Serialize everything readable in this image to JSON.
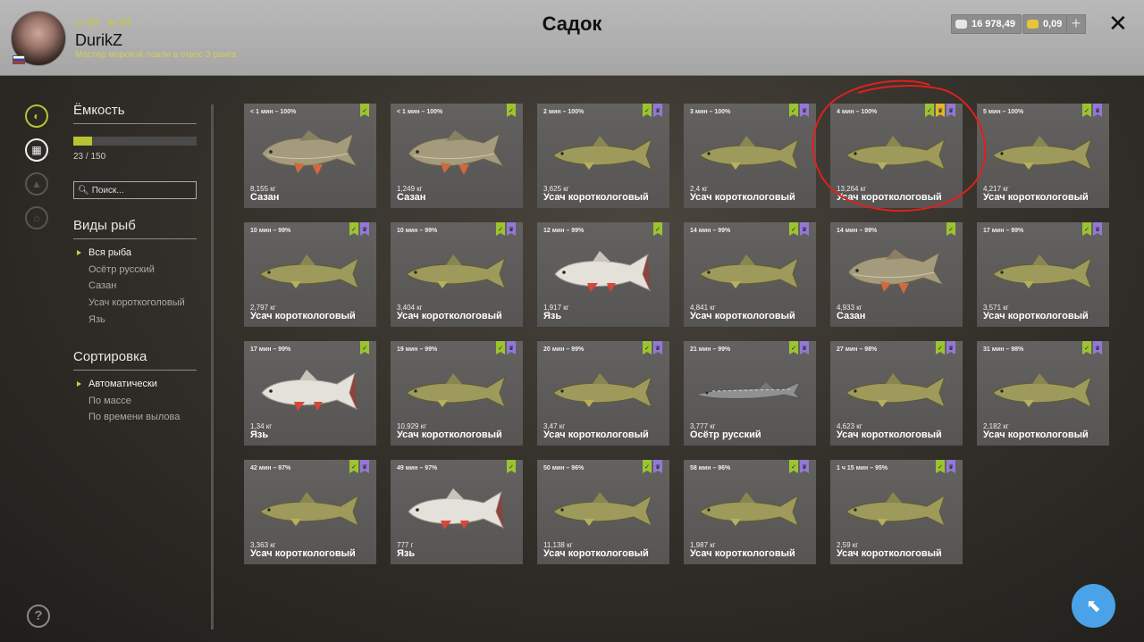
{
  "header": {
    "title": "Садок",
    "username": "DurikZ",
    "rank": "Мастер морской ловли в отвес 3 ранга",
    "level": "39",
    "stars": "34",
    "silver": "16 978,49",
    "gold": "0,09"
  },
  "sidebar": {
    "capacity_title": "Ёмкость",
    "capacity_text": "23 / 150",
    "capacity_fraction": 0.153,
    "search_placeholder": "Поиск...",
    "species_title": "Виды рыб",
    "species": [
      "Вся рыба",
      "Осётр русский",
      "Сазан",
      "Усач короткоголовый",
      "Язь"
    ],
    "sort_title": "Сортировка",
    "sort": [
      "Автоматически",
      "По массе",
      "По времени вылова"
    ]
  },
  "fish": [
    {
      "time": "< 1 мин – 100%",
      "weight": "8,155 кг",
      "name": "Сазан",
      "kind": "carp",
      "marks": [
        "g"
      ]
    },
    {
      "time": "< 1 мин – 100%",
      "weight": "1,249 кг",
      "name": "Сазан",
      "kind": "carp",
      "marks": [
        "g"
      ]
    },
    {
      "time": "2 мин – 100%",
      "weight": "3,625 кг",
      "name": "Усач короткологовый",
      "kind": "barbel",
      "marks": [
        "g",
        "p"
      ]
    },
    {
      "time": "3 мин – 100%",
      "weight": "2,4 кг",
      "name": "Усач короткологовый",
      "kind": "barbel",
      "marks": [
        "g",
        "p"
      ]
    },
    {
      "time": "4 мин – 100%",
      "weight": "13,264 кг",
      "name": "Усач короткологовый",
      "kind": "barbel",
      "marks": [
        "g",
        "y",
        "p"
      ]
    },
    {
      "time": "5 мин – 100%",
      "weight": "4,217 кг",
      "name": "Усач короткологовый",
      "kind": "barbel",
      "marks": [
        "g",
        "p"
      ]
    },
    {
      "time": "10 мин – 99%",
      "weight": "2,797 кг",
      "name": "Усач короткологовый",
      "kind": "barbel",
      "marks": [
        "g",
        "p"
      ]
    },
    {
      "time": "10 мин – 99%",
      "weight": "3,404 кг",
      "name": "Усач короткологовый",
      "kind": "barbel",
      "marks": [
        "g",
        "p"
      ]
    },
    {
      "time": "12 мин – 99%",
      "weight": "1,917 кг",
      "name": "Язь",
      "kind": "ide",
      "marks": [
        "g"
      ]
    },
    {
      "time": "14 мин – 99%",
      "weight": "4,841 кг",
      "name": "Усач короткологовый",
      "kind": "barbel",
      "marks": [
        "g",
        "p"
      ]
    },
    {
      "time": "14 мин – 99%",
      "weight": "4,933 кг",
      "name": "Сазан",
      "kind": "carp",
      "marks": [
        "g"
      ]
    },
    {
      "time": "17 мин – 99%",
      "weight": "3,571 кг",
      "name": "Усач короткологовый",
      "kind": "barbel",
      "marks": [
        "g",
        "p"
      ]
    },
    {
      "time": "17 мин – 99%",
      "weight": "1,34 кг",
      "name": "Язь",
      "kind": "ide",
      "marks": [
        "g"
      ]
    },
    {
      "time": "19 мин – 99%",
      "weight": "10,929 кг",
      "name": "Усач короткологовый",
      "kind": "barbel",
      "marks": [
        "g",
        "p"
      ]
    },
    {
      "time": "20 мин – 99%",
      "weight": "3,47 кг",
      "name": "Усач короткологовый",
      "kind": "barbel",
      "marks": [
        "g",
        "p"
      ]
    },
    {
      "time": "21 мин – 99%",
      "weight": "3,777 кг",
      "name": "Осётр русский",
      "kind": "sturgeon",
      "marks": [
        "g",
        "p"
      ]
    },
    {
      "time": "27 мин – 98%",
      "weight": "4,623 кг",
      "name": "Усач короткологовый",
      "kind": "barbel",
      "marks": [
        "g",
        "p"
      ]
    },
    {
      "time": "31 мин – 98%",
      "weight": "2,182 кг",
      "name": "Усач короткологовый",
      "kind": "barbel",
      "marks": [
        "g",
        "p"
      ]
    },
    {
      "time": "42 мин – 97%",
      "weight": "3,363 кг",
      "name": "Усач короткологовый",
      "kind": "barbel",
      "marks": [
        "g",
        "p"
      ]
    },
    {
      "time": "49 мин – 97%",
      "weight": "777 г",
      "name": "Язь",
      "kind": "ide",
      "marks": [
        "g"
      ]
    },
    {
      "time": "50 мин – 96%",
      "weight": "11,138 кг",
      "name": "Усач короткологовый",
      "kind": "barbel",
      "marks": [
        "g",
        "p"
      ]
    },
    {
      "time": "58 мин – 96%",
      "weight": "1,987 кг",
      "name": "Усач короткологовый",
      "kind": "barbel",
      "marks": [
        "g",
        "p"
      ]
    },
    {
      "time": "1 ч 15 мин – 95%",
      "weight": "2,59 кг",
      "name": "Усач короткологовый",
      "kind": "barbel",
      "marks": [
        "g",
        "p"
      ]
    }
  ],
  "icons": {
    "nav": [
      "fish-icon",
      "keepnet-icon",
      "tackle-icon",
      "home-icon"
    ],
    "help": "help-icon",
    "cursor": "cursor-icon"
  },
  "colors": {
    "accent": "#b7c332",
    "mark_green": "#9cc331",
    "mark_purple": "#9478d6",
    "mark_yellow": "#e0b62a",
    "annotation": "#e0201c"
  }
}
